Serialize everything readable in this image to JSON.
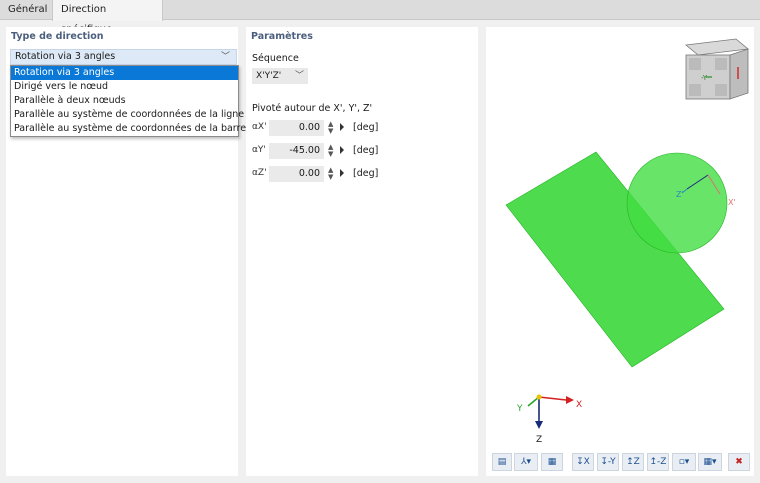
{
  "tabs": [
    {
      "label": "Général"
    },
    {
      "label": "Direction spécifique"
    }
  ],
  "left": {
    "title": "Type de direction",
    "selected": "Rotation via 3 angles",
    "options": [
      "Rotation via 3 angles",
      "Dirigé vers le nœud",
      "Parallèle à deux nœuds",
      "Parallèle au système de coordonnées de la ligne",
      "Parallèle au système de coordonnées de la barre"
    ]
  },
  "params": {
    "title": "Paramètres",
    "sequence_label": "Séquence",
    "sequence_value": "X'Y'Z'",
    "rotation_label": "Pivoté autour de X', Y', Z'",
    "angles": [
      {
        "symbol": "αX'",
        "value": "0.00",
        "unit": "[deg]"
      },
      {
        "symbol": "αY'",
        "value": "-45.00",
        "unit": "[deg]"
      },
      {
        "symbol": "αZ'",
        "value": "0.00",
        "unit": "[deg]"
      }
    ]
  },
  "view": {
    "cube_face_label": "-Y",
    "local_axes": {
      "x": "X'",
      "z": "Z'"
    },
    "global_axes": {
      "x": "X",
      "y": "Y",
      "z": "Z"
    },
    "colors": {
      "shape": "#2fd62f",
      "x_axis": "#d42020",
      "y_axis": "#2aa52a",
      "z_axis": "#1a2a7a",
      "selection": "#0a78d7"
    },
    "toolbar": [
      {
        "icon": "layers-icon",
        "glyph": "▤"
      },
      {
        "icon": "axis-dropdown-icon",
        "glyph": "⅄▾"
      },
      {
        "icon": "render-icon",
        "glyph": "▦"
      },
      {
        "icon": "view-x-icon",
        "glyph": "↧X"
      },
      {
        "icon": "view-minus-y-icon",
        "glyph": "↧-Y"
      },
      {
        "icon": "view-z-icon",
        "glyph": "↥Z"
      },
      {
        "icon": "view-minus-z-icon",
        "glyph": "↥-Z"
      },
      {
        "icon": "display-dropdown-icon",
        "glyph": "▫▾"
      },
      {
        "icon": "grid-dropdown-icon",
        "glyph": "▦▾"
      },
      {
        "icon": "reset-view-icon",
        "glyph": "✖"
      }
    ]
  }
}
